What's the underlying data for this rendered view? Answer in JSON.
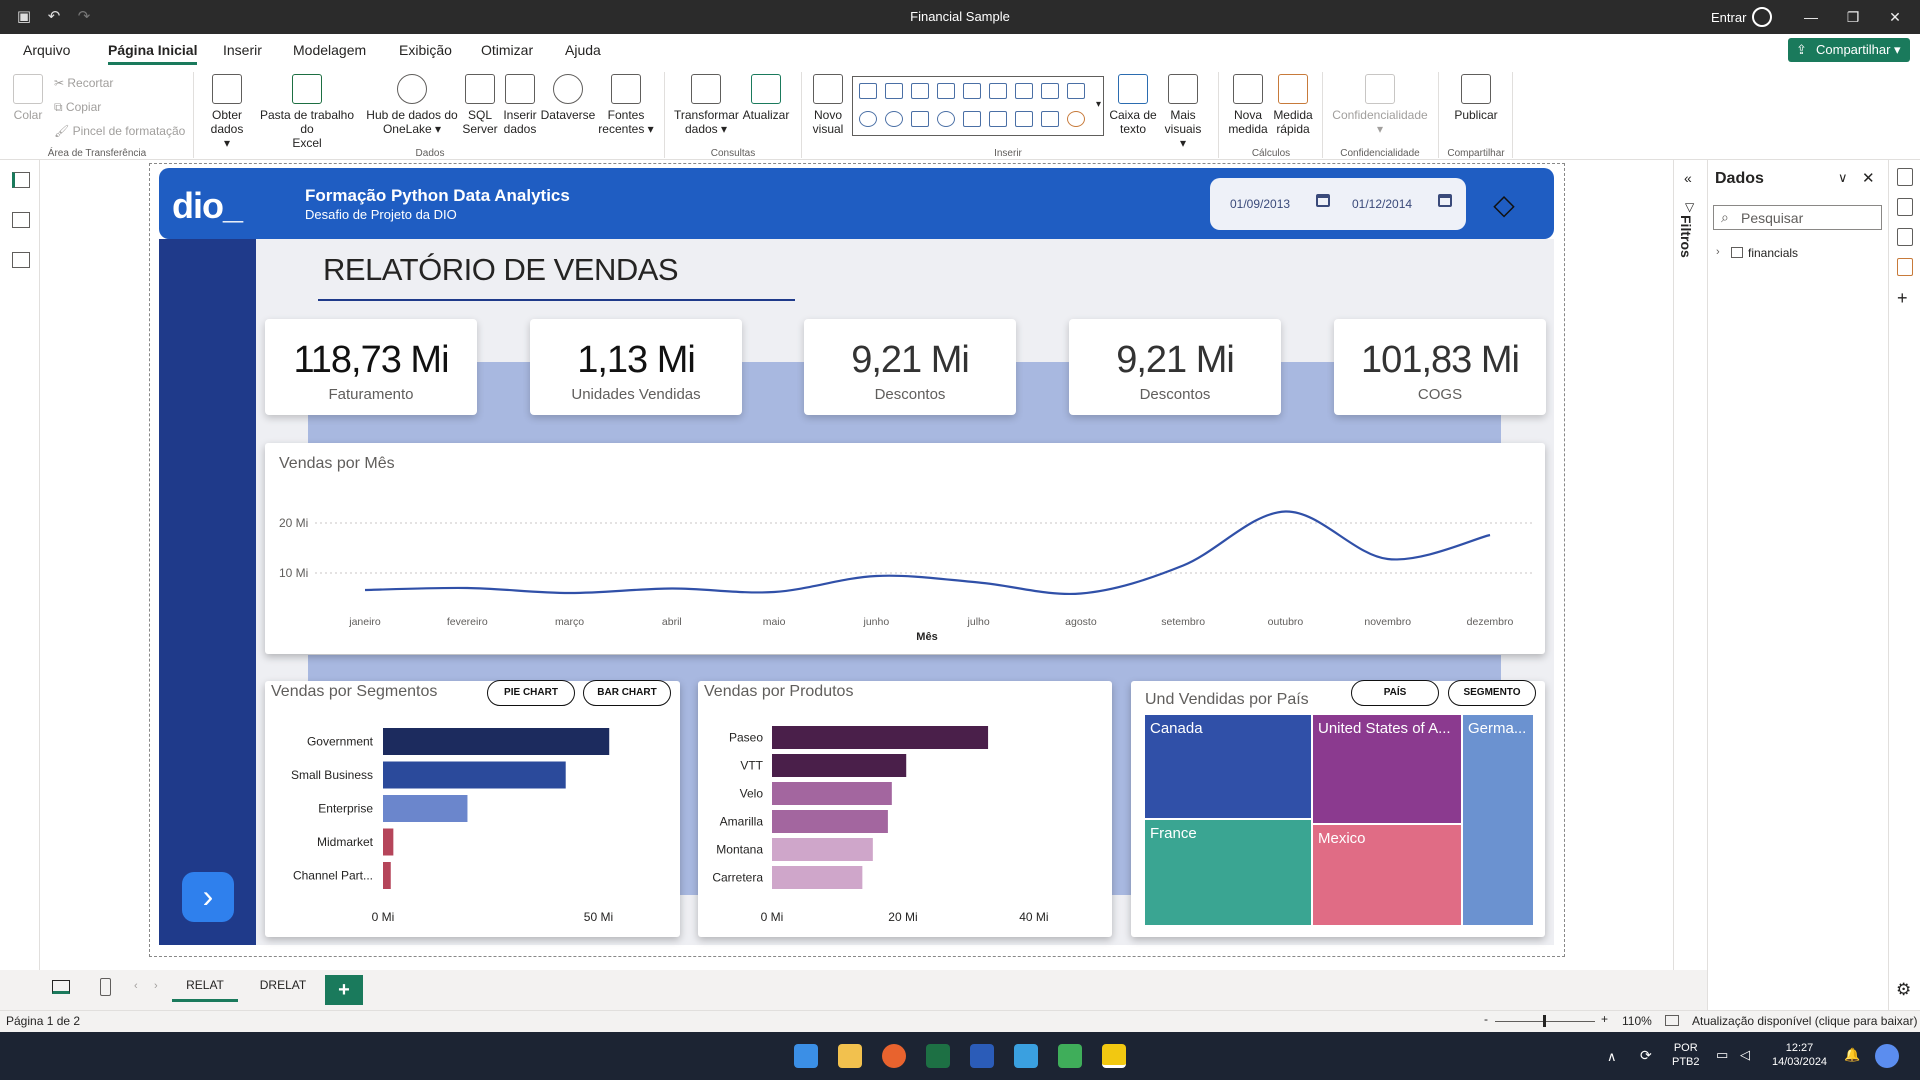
{
  "titlebar": {
    "app_title": "Financial Sample",
    "signin": "Entrar"
  },
  "menu": {
    "items": [
      "Arquivo",
      "Página Inicial",
      "Inserir",
      "Modelagem",
      "Exibição",
      "Otimizar",
      "Ajuda"
    ],
    "share": "Compartilhar"
  },
  "ribbon": {
    "clipboard": {
      "paste": "Colar",
      "cut": "Recortar",
      "copy": "Copiar",
      "format_painter": "Pincel de formatação",
      "group": "Área de Transferência"
    },
    "data": {
      "get_data_1": "Obter",
      "get_data_2": "dados",
      "excel_1": "Pasta de trabalho do",
      "excel_2": "Excel",
      "onelake_1": "Hub de dados do",
      "onelake_2": "OneLake",
      "sql_1": "SQL",
      "sql_2": "Server",
      "enter_1": "Inserir",
      "enter_2": "dados",
      "dataverse": "Dataverse",
      "recent_1": "Fontes",
      "recent_2": "recentes",
      "group": "Dados"
    },
    "queries": {
      "transform_1": "Transformar",
      "transform_2": "dados",
      "refresh": "Atualizar",
      "group": "Consultas"
    },
    "insert": {
      "new_visual_1": "Novo",
      "new_visual_2": "visual",
      "textbox_1": "Caixa de",
      "textbox_2": "texto",
      "more_1": "Mais",
      "more_2": "visuais",
      "group": "Inserir"
    },
    "calc": {
      "measure_1": "Nova",
      "measure_2": "medida",
      "quick_1": "Medida",
      "quick_2": "rápida",
      "group": "Cálculos"
    },
    "sensitivity": {
      "label": "Confidencialidade",
      "group": "Confidencialidade"
    },
    "share": {
      "publish": "Publicar",
      "group": "Compartilhar"
    }
  },
  "report": {
    "logo": "dio_",
    "header_title": "Formação Python Data Analytics",
    "header_subtitle": "Desafio de Projeto da DIO",
    "date_start": "01/09/2013",
    "date_end": "01/12/2014",
    "title": "RELATÓRIO DE VENDAS",
    "kpis": [
      {
        "value": "118,73 Mi",
        "label": "Faturamento"
      },
      {
        "value": "1,13 Mi",
        "label": "Unidades Vendidas"
      },
      {
        "value": "9,21 Mi",
        "label": "Descontos"
      },
      {
        "value": "9,21 Mi",
        "label": "Descontos"
      },
      {
        "value": "101,83 Mi",
        "label": "COGS"
      }
    ]
  },
  "chart_data": [
    {
      "type": "line",
      "title": "Vendas por Mês",
      "xlabel": "Mês",
      "ylabel": "",
      "categories": [
        "janeiro",
        "fevereiro",
        "março",
        "abril",
        "maio",
        "junho",
        "julho",
        "agosto",
        "setembro",
        "outubro",
        "novembro",
        "dezembro"
      ],
      "values": [
        6.6,
        7.0,
        6.0,
        6.9,
        6.2,
        9.4,
        8.1,
        5.9,
        11.5,
        22.3,
        12.8,
        17.6
      ],
      "ytick_labels": [
        "10 Mi",
        "20 Mi"
      ],
      "yticks": [
        10,
        20
      ],
      "ylim": [
        0,
        26
      ],
      "color": "#3050a8",
      "grid": true
    },
    {
      "type": "bar",
      "orientation": "horizontal",
      "title": "Vendas por Segmentos",
      "categories": [
        "Government",
        "Small Business",
        "Enterprise",
        "Midmarket",
        "Channel Part..."
      ],
      "values": [
        52.5,
        42.4,
        19.6,
        2.4,
        1.8
      ],
      "colors": [
        "#1c2b5e",
        "#2b4a9b",
        "#6b86cc",
        "#b5455a",
        "#b5455a"
      ],
      "xtick_labels": [
        "0 Mi",
        "50 Mi"
      ],
      "xticks": [
        0,
        50
      ],
      "xlim": [
        0,
        55
      ],
      "buttons": [
        "PIE CHART",
        "BAR CHART"
      ]
    },
    {
      "type": "bar",
      "orientation": "horizontal",
      "title": "Vendas por Produtos",
      "categories": [
        "Paseo",
        "VTT",
        "Velo",
        "Amarilla",
        "Montana",
        "Carretera"
      ],
      "values": [
        33.0,
        20.5,
        18.3,
        17.7,
        15.4,
        13.8
      ],
      "colors": [
        "#4a1f4a",
        "#4a1f4a",
        "#a3669f",
        "#a3669f",
        "#cfa6ca",
        "#cfa6ca"
      ],
      "xtick_labels": [
        "0 Mi",
        "20 Mi",
        "40 Mi"
      ],
      "xticks": [
        0,
        20,
        40
      ],
      "xlim": [
        0,
        42
      ]
    },
    {
      "type": "treemap",
      "title": "Und Vendidas por País",
      "categories": [
        "Canada",
        "France",
        "United States of A...",
        "Mexico",
        "Germa..."
      ],
      "colors": [
        "#3050a8",
        "#3aa592",
        "#8b3a8f",
        "#e06c85",
        "#6b92d0"
      ],
      "buttons": [
        "PAÍS",
        "SEGMENTO"
      ]
    }
  ],
  "right_pane": {
    "filters": "Filtros",
    "data_title": "Dados",
    "search_placeholder": "Pesquisar",
    "table": "financials"
  },
  "tabs": [
    "RELAT",
    "DRELAT"
  ],
  "status": {
    "page": "Página 1 de 2",
    "zoom": "110%",
    "update": "Atualização disponível (clique para baixar)"
  },
  "taskbar": {
    "lang1": "POR",
    "lang2": "PTB2",
    "time": "12:27",
    "date": "14/03/2024"
  }
}
